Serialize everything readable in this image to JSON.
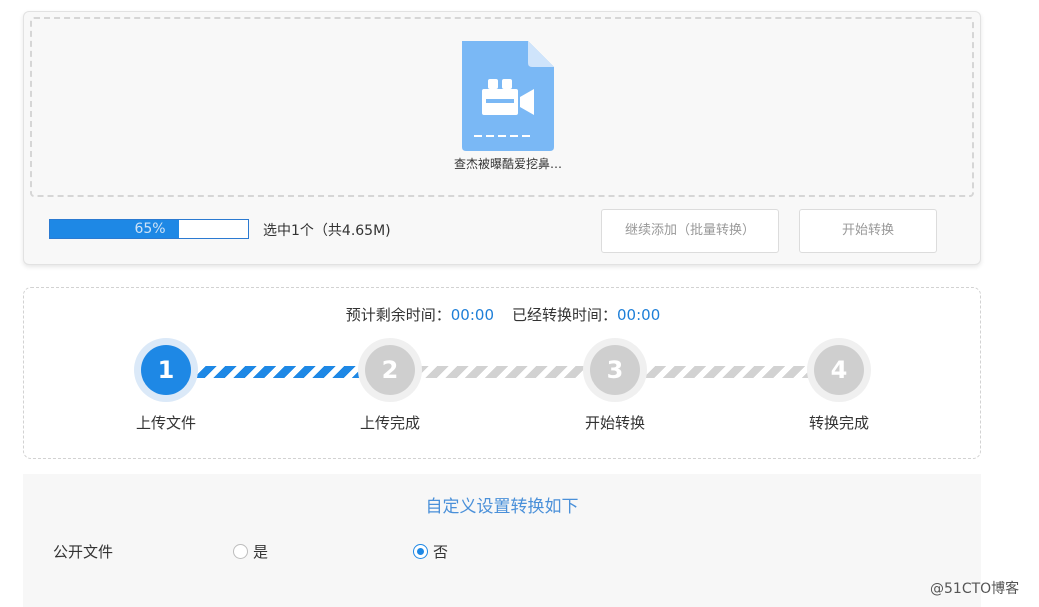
{
  "upload": {
    "file_icon": "video-file-icon",
    "file_name": "查杰被曝酷爱挖鼻…",
    "progress_percent": 65,
    "progress_label": "65%",
    "selected_info": "选中1个（共4.65M)",
    "continue_button": "继续添加（批量转换）",
    "start_button": "开始转换"
  },
  "status": {
    "remaining_label": "预计剩余时间：",
    "remaining_value": "00:00",
    "elapsed_label": "已经转换时间：",
    "elapsed_value": "00:00",
    "current_step": 1,
    "steps": [
      {
        "number": "1",
        "label": "上传文件"
      },
      {
        "number": "2",
        "label": "上传完成"
      },
      {
        "number": "3",
        "label": "开始转换"
      },
      {
        "number": "4",
        "label": "转换完成"
      }
    ]
  },
  "settings": {
    "title": "自定义设置转换如下",
    "public_file_label": "公开文件",
    "options": [
      {
        "label": "是",
        "checked": false
      },
      {
        "label": "否",
        "checked": true
      }
    ]
  },
  "watermark": "@51CTO博客",
  "colors": {
    "accent": "#1e88e5",
    "inactive_step": "#cfcfcf",
    "settings_title": "#4a90d9",
    "file_icon": "#7ab8f5"
  }
}
